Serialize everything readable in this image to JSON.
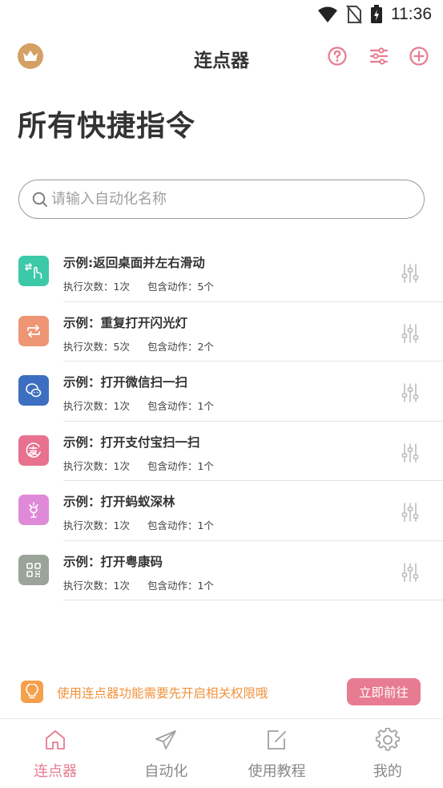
{
  "status_bar": {
    "time": "11:36"
  },
  "app_bar": {
    "title": "连点器"
  },
  "page": {
    "title": "所有快捷指令"
  },
  "search": {
    "placeholder": "请输入自动化名称"
  },
  "list": {
    "items": [
      {
        "title": "示例:返回桌面并左右滑动",
        "runs": "执行次数：1次",
        "actions": "包含动作：5个",
        "icon": "swipe-hand-icon",
        "color": "#3cc9a8"
      },
      {
        "title": "示例：重复打开闪光灯",
        "runs": "执行次数：5次",
        "actions": "包含动作：2个",
        "icon": "repeat-icon",
        "color": "#ee9575"
      },
      {
        "title": "示例：打开微信扫一扫",
        "runs": "执行次数：1次",
        "actions": "包含动作：1个",
        "icon": "wechat-icon",
        "color": "#3d6fc0"
      },
      {
        "title": "示例：打开支付宝扫一扫",
        "runs": "执行次数：1次",
        "actions": "包含动作：1个",
        "icon": "alipay-icon",
        "color": "#e7718e"
      },
      {
        "title": "示例：打开蚂蚁深林",
        "runs": "执行次数：1次",
        "actions": "包含动作：1个",
        "icon": "sprout-icon",
        "color": "#df8ad8"
      },
      {
        "title": "示例：打开粤康码",
        "runs": "执行次数：1次",
        "actions": "包含动作：1个",
        "icon": "qr-code-icon",
        "color": "#9aa498"
      }
    ]
  },
  "notice": {
    "text": "使用连点器功能需要先开启相关权限哦",
    "button": "立即前往"
  },
  "bottom_nav": {
    "items": [
      {
        "label": "连点器",
        "icon": "home-icon",
        "active": true
      },
      {
        "label": "自动化",
        "icon": "send-icon",
        "active": false
      },
      {
        "label": "使用教程",
        "icon": "edit-icon",
        "active": false
      },
      {
        "label": "我的",
        "icon": "gear-icon",
        "active": false
      }
    ]
  },
  "colors": {
    "accent": "#e77b92",
    "crown": "#d4a063",
    "notice": "#f0923c"
  }
}
